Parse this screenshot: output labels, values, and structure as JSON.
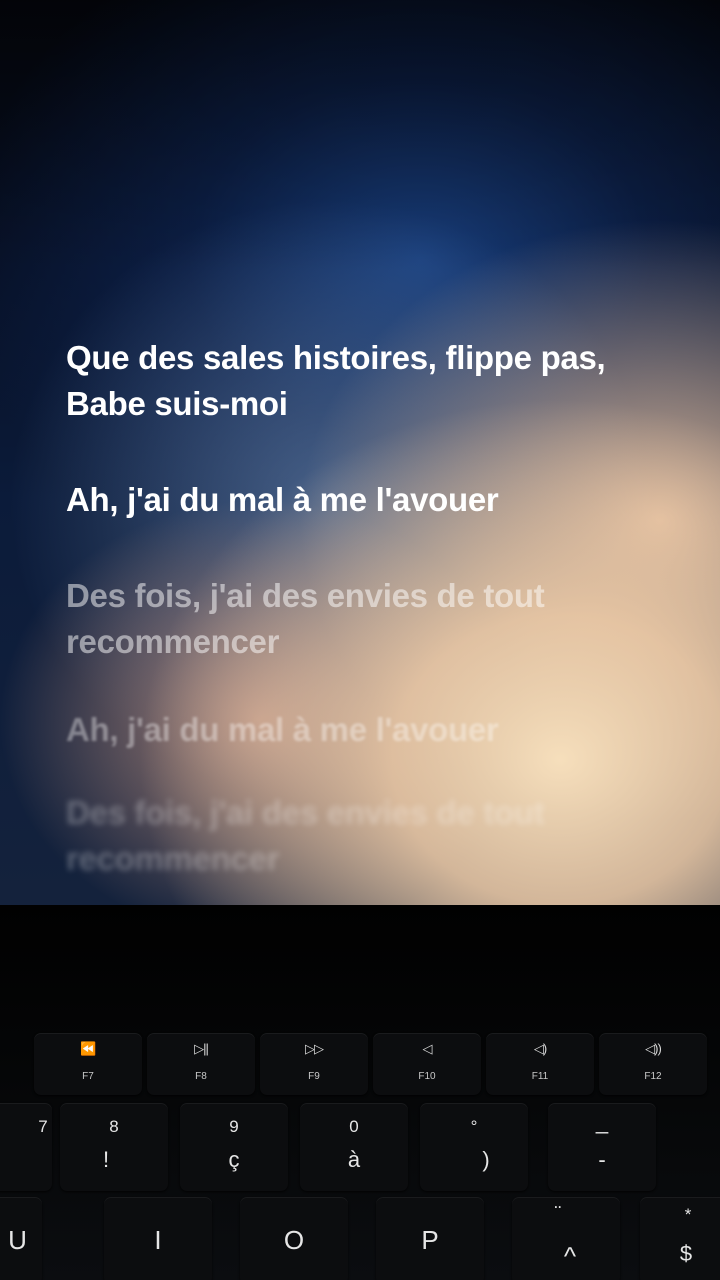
{
  "lyrics": [
    {
      "text": "Que des sales histoires, flippe pas, Babe suis-moi",
      "state": "past"
    },
    {
      "text": "Ah, j'ai du mal à me l'avouer",
      "state": "current"
    },
    {
      "text": "Des fois, j'ai des envies de tout recommencer",
      "state": "upcoming"
    },
    {
      "text": "Ah, j'ai du mal à me l'avouer",
      "state": "upcoming"
    },
    {
      "text": "Des fois, j'ai des envies de tout recommencer",
      "state": "upcoming"
    }
  ],
  "keyboard": {
    "function_keys": [
      {
        "icon": "⏪",
        "label": "F7",
        "icon_name": "rewind-icon"
      },
      {
        "icon": "▷||",
        "label": "F8",
        "icon_name": "play-pause-icon"
      },
      {
        "icon": "▷▷",
        "label": "F9",
        "icon_name": "fast-forward-icon"
      },
      {
        "icon": "◁",
        "label": "F10",
        "icon_name": "mute-icon"
      },
      {
        "icon": "◁)",
        "label": "F11",
        "icon_name": "volume-down-icon"
      },
      {
        "icon": "◁))",
        "label": "F12",
        "icon_name": "volume-up-icon"
      }
    ],
    "number_keys": [
      {
        "top": "7",
        "bottom": ""
      },
      {
        "top": "8",
        "bottom": "!"
      },
      {
        "top": "9",
        "bottom": "ç"
      },
      {
        "top": "0",
        "bottom": "à"
      },
      {
        "top": "°",
        "bottom": ")"
      },
      {
        "top": "_",
        "bottom": "-"
      }
    ],
    "letter_keys": [
      {
        "top": "",
        "main": "U"
      },
      {
        "top": "",
        "main": "I"
      },
      {
        "top": "",
        "main": "O"
      },
      {
        "top": "",
        "main": "P"
      },
      {
        "top": "¨",
        "main": "^"
      },
      {
        "top": "*",
        "main": "$"
      }
    ]
  }
}
